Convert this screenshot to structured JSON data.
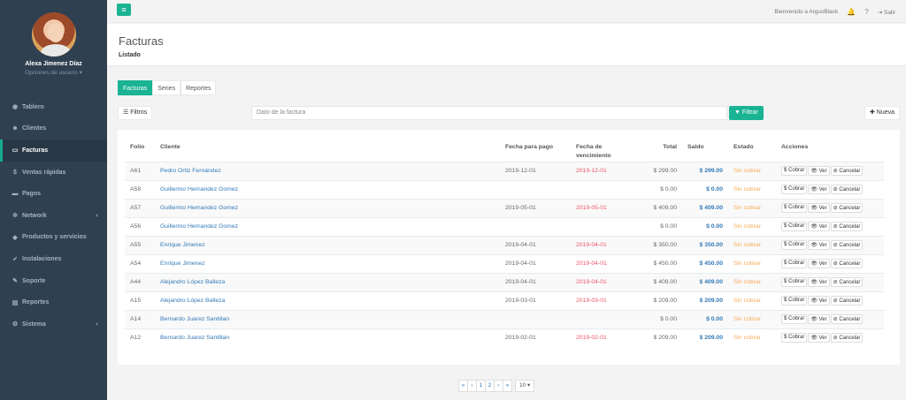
{
  "user": {
    "name": "Alexa Jimenez Díaz",
    "options": "Opciones de usuario ▾"
  },
  "nav": [
    {
      "icon": "tachometer-icon",
      "glyph": "◉",
      "label": "Tablero",
      "caret": ""
    },
    {
      "icon": "users-icon",
      "glyph": "☻",
      "label": "Clientes",
      "caret": ""
    },
    {
      "icon": "file-icon",
      "glyph": "▭",
      "label": "Facturas",
      "caret": "",
      "active": true
    },
    {
      "icon": "dollar-icon",
      "glyph": "$",
      "label": "Ventas rápidas",
      "caret": ""
    },
    {
      "icon": "money-icon",
      "glyph": "▬",
      "label": "Pagos",
      "caret": ""
    },
    {
      "icon": "network-icon",
      "glyph": "✲",
      "label": "Network",
      "caret": "‹"
    },
    {
      "icon": "tags-icon",
      "glyph": "◆",
      "label": "Productos y servicios",
      "caret": ""
    },
    {
      "icon": "rocket-icon",
      "glyph": "➶",
      "label": "Instalaciones",
      "caret": ""
    },
    {
      "icon": "wrench-icon",
      "glyph": "✎",
      "label": "Soporte",
      "caret": ""
    },
    {
      "icon": "chart-icon",
      "glyph": "▤",
      "label": "Reportes",
      "caret": ""
    },
    {
      "icon": "cogs-icon",
      "glyph": "⚙",
      "label": "Sistema",
      "caret": "‹"
    }
  ],
  "topbar": {
    "menu_glyph": "≡",
    "welcome": "Bienvenido a ArgusBlack",
    "bell": "🔔",
    "help": "?",
    "logout_glyph": "⇥",
    "logout": "Salir"
  },
  "heading": {
    "title": "Facturas",
    "crumb": "Listado"
  },
  "tabs": [
    "Facturas",
    "Series",
    "Reportes"
  ],
  "toolbar": {
    "filters": "☰ Filtros",
    "search_placeholder": "Dato de la factura",
    "filter": "▼ Filtrar",
    "new": "✚ Nueva"
  },
  "table": {
    "headers": [
      "Folio",
      "Cliente",
      "Fecha para pago",
      "Fecha de vencimiento",
      "Total",
      "Saldo",
      "Estado",
      "Acciones"
    ],
    "rows": [
      [
        "A61",
        "Pedro Ortiz Fernández",
        "2019-12-01",
        "2019-12-01",
        "$ 299.00",
        "$ 299.00",
        "Sin cobrar"
      ],
      [
        "A58",
        "Guillermo Hernandez Gomez",
        "",
        "",
        "$ 0.00",
        "$ 0.00",
        "Sin cobrar"
      ],
      [
        "A57",
        "Guillermo Hernandez Gomez",
        "2019-05-01",
        "2019-05-01",
        "$ 409.00",
        "$ 409.00",
        "Sin cobrar"
      ],
      [
        "A56",
        "Guillermo Hernandez Gomez",
        "",
        "",
        "$ 0.00",
        "$ 0.00",
        "Sin cobrar"
      ],
      [
        "A55",
        "Enrique Jimenez",
        "2019-04-01",
        "2019-04-01",
        "$ 350.00",
        "$ 350.00",
        "Sin cobrar"
      ],
      [
        "A54",
        "Enrique Jimenez",
        "2019-04-01",
        "2019-04-01",
        "$ 450.00",
        "$ 450.00",
        "Sin cobrar"
      ],
      [
        "A44",
        "Alejandro López Balleza",
        "2019-04-01",
        "2019-04-01",
        "$ 409.00",
        "$ 409.00",
        "Sin cobrar"
      ],
      [
        "A15",
        "Alejandro López Balleza",
        "2019-03-01",
        "2019-03-01",
        "$ 209.00",
        "$ 209.00",
        "Sin cobrar"
      ],
      [
        "A14",
        "Bernardo Juarez Santillan",
        "",
        "",
        "$ 0.00",
        "$ 0.00",
        "Sin cobrar"
      ],
      [
        "A12",
        "Bernardo Juarez Santillan",
        "2019-02-01",
        "2019-02-01",
        "$ 209.00",
        "$ 209.00",
        "Sin cobrar"
      ]
    ],
    "actions": [
      "$ Cobrar",
      "👁 Ver",
      "⊘ Cancelar"
    ]
  },
  "pager": {
    "first": "«",
    "prev": "‹",
    "pages": [
      "1",
      "2"
    ],
    "next": "›",
    "last": "»",
    "per_page": "10 ▾"
  }
}
